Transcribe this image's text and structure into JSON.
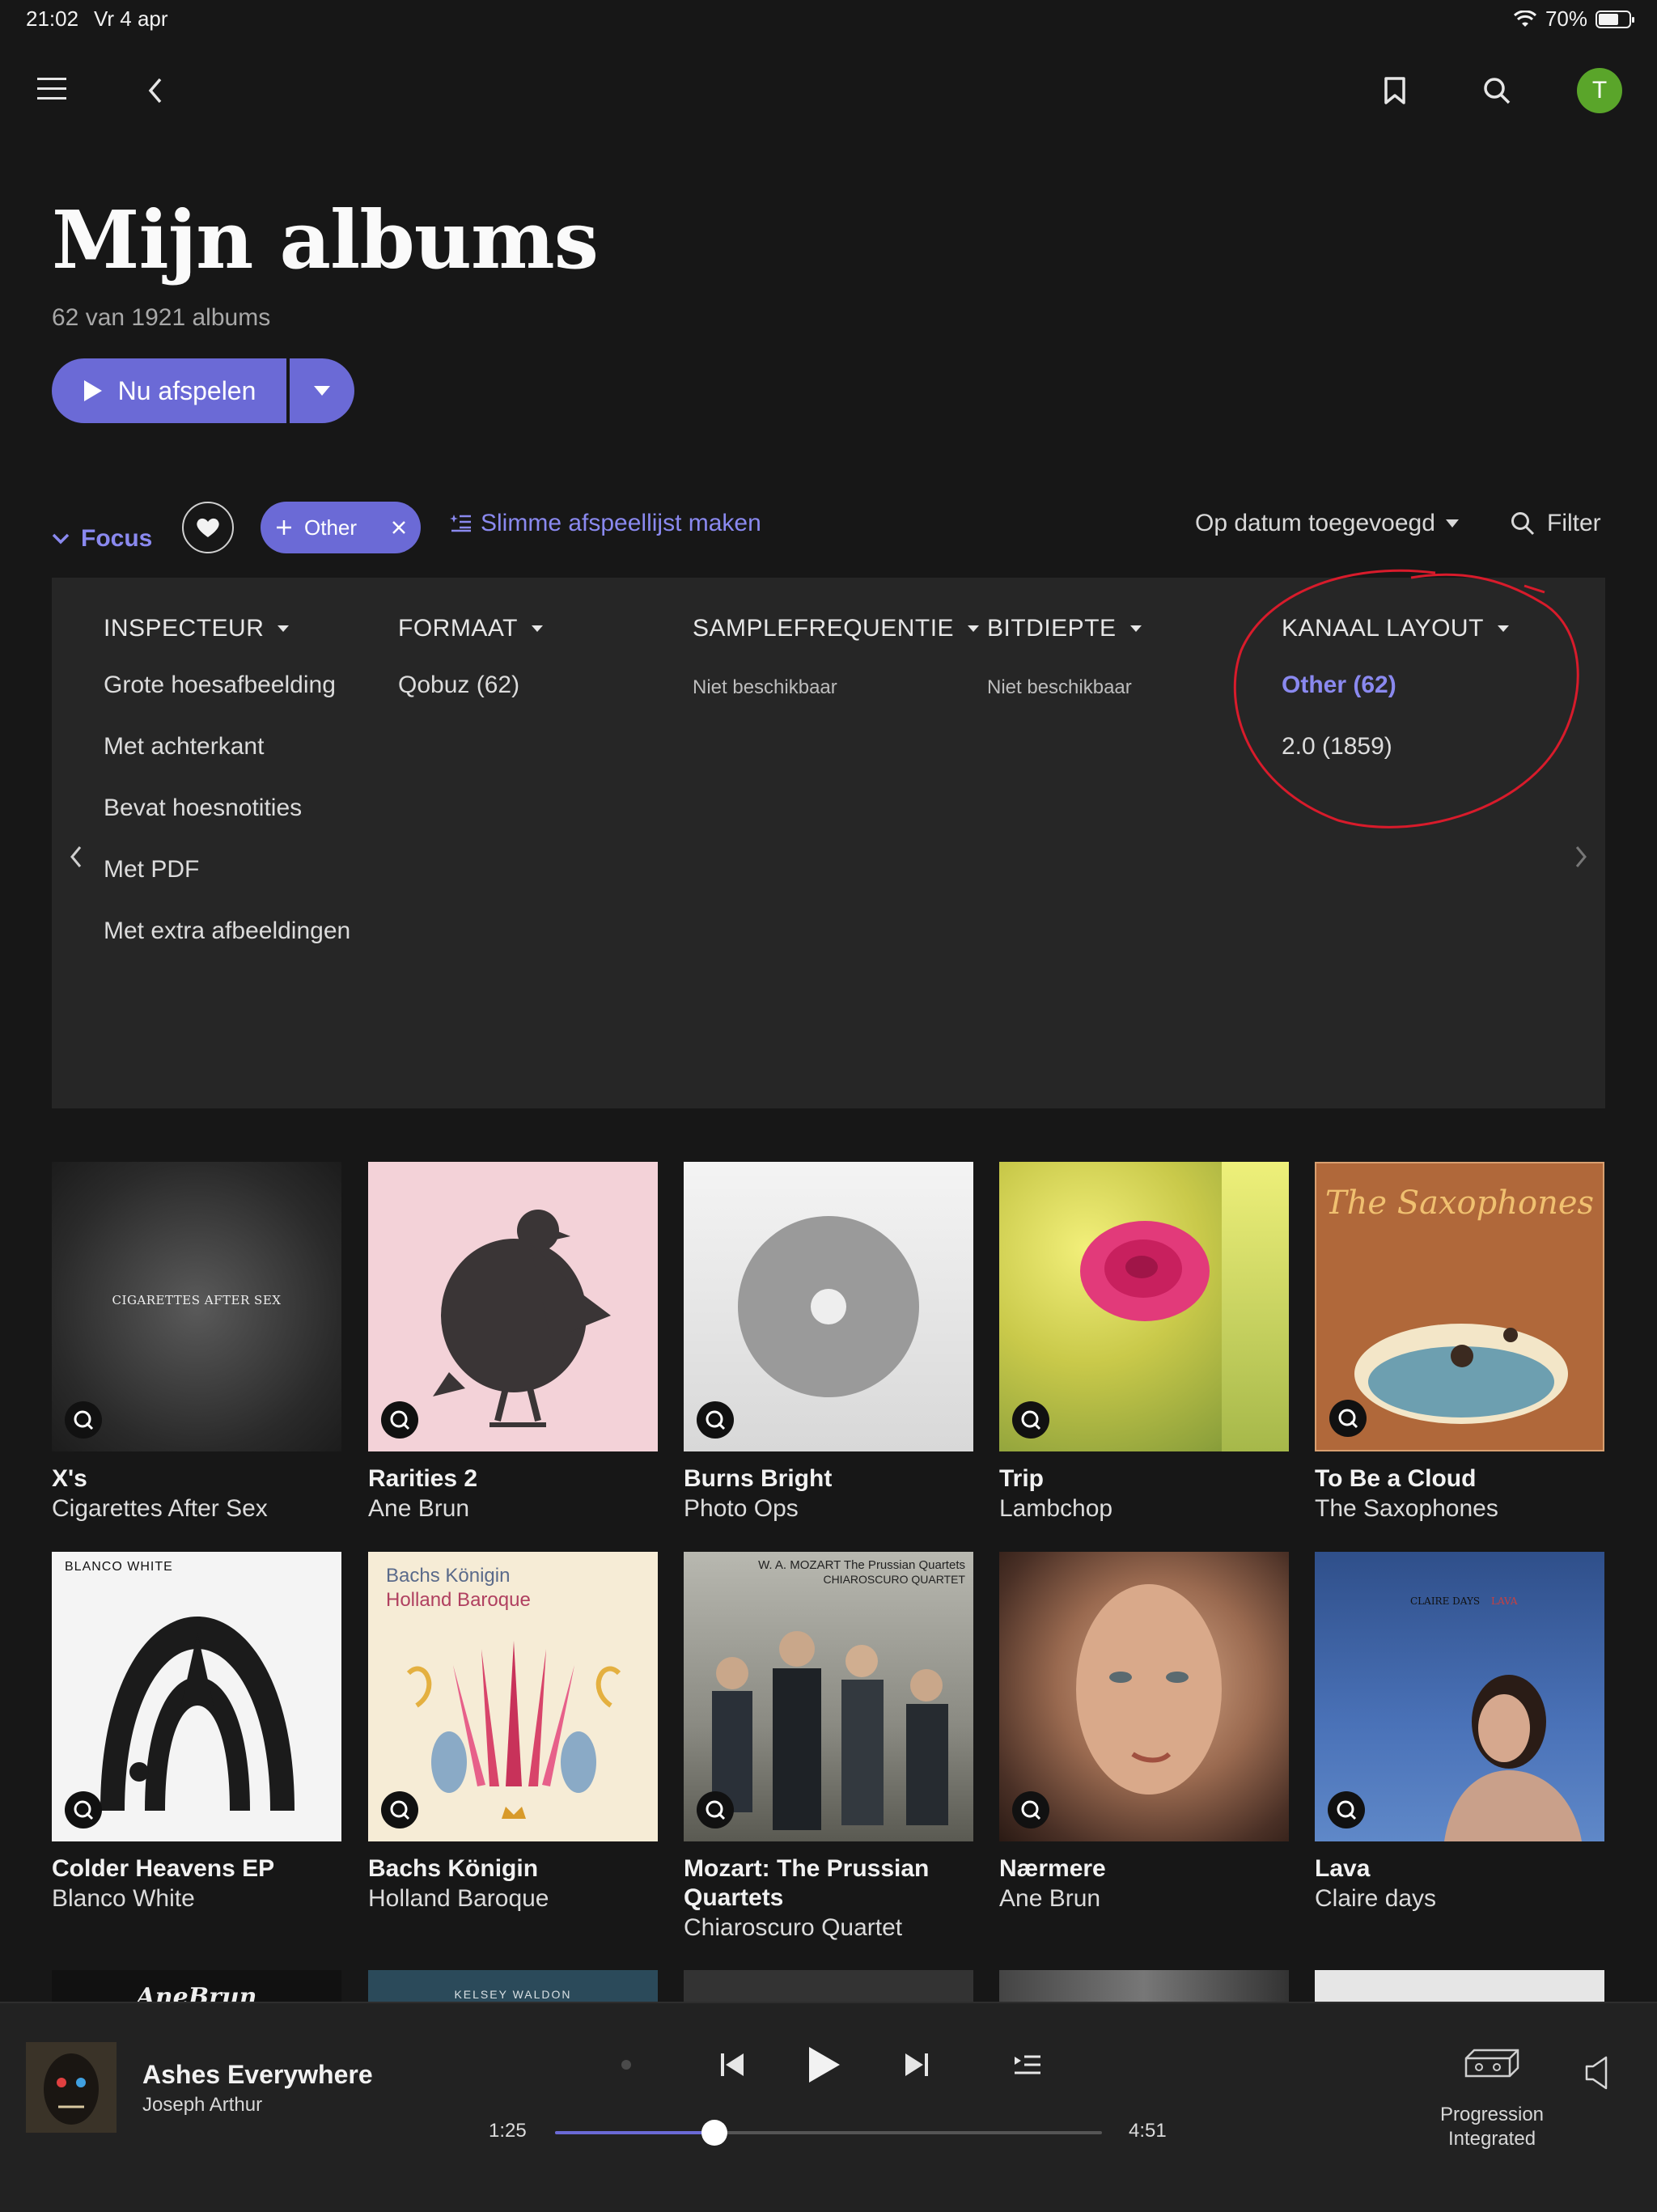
{
  "status": {
    "time": "21:02",
    "date": "Vr 4 apr",
    "battery": "70%",
    "battery_level": 0.7
  },
  "header": {
    "avatar_initial": "T"
  },
  "page": {
    "title": "Mijn albums",
    "subtitle": "62 van 1921 albums",
    "play_label": "Nu afspelen"
  },
  "toolbar": {
    "focus_label": "Focus",
    "chip_label": "Other",
    "smart_playlist_label": "Slimme afspeellijst maken",
    "sort_label": "Op datum toegevoegd",
    "filter_label": "Filter"
  },
  "focus_panel": {
    "columns": [
      {
        "header": "INSPECTEUR",
        "items": [
          "Grote hoesafbeelding",
          "Met achterkant",
          "Bevat hoesnotities",
          "Met PDF",
          "Met extra afbeeldingen"
        ]
      },
      {
        "header": "FORMAAT",
        "items": [
          "Qobuz (62)"
        ]
      },
      {
        "header": "SAMPLEFREQUENTIE",
        "items": [
          "Niet beschikbaar"
        ]
      },
      {
        "header": "BITDIEPTE",
        "items": [
          "Niet beschikbaar"
        ]
      },
      {
        "header": "KANAAL LAYOUT",
        "items": [
          "Other (62)",
          "2.0 (1859)"
        ],
        "selected": "Other (62)"
      }
    ]
  },
  "albums": [
    {
      "title": "X's",
      "artist": "Cigarettes After Sex",
      "cover_text": "CIGARETTES AFTER SEX",
      "color": "#3a3a3a"
    },
    {
      "title": "Rarities 2",
      "artist": "Ane Brun",
      "cover_text": "",
      "color": "#f3d2d8"
    },
    {
      "title": "Burns Bright",
      "artist": "Photo Ops",
      "cover_text": "",
      "color": "#e8e8e8"
    },
    {
      "title": "Trip",
      "artist": "Lambchop",
      "cover_text": "",
      "color": "#d9d25a"
    },
    {
      "title": "To Be a Cloud",
      "artist": "The Saxophones",
      "cover_text": "The Saxophones",
      "color": "#b0683a"
    },
    {
      "title": "Colder Heavens EP",
      "artist": "Blanco White",
      "cover_text": "BLANCO WHITE",
      "color": "#f4f4f4"
    },
    {
      "title": "Bachs Königin",
      "artist": "Holland Baroque",
      "cover_text": "Bachs Königin",
      "cover_sub": "Holland Baroque",
      "color": "#f6ecd6"
    },
    {
      "title": "Mozart: The Prussian Quartets",
      "artist": "Chiaroscuro Quartet",
      "cover_text": "W. A. MOZART  The Prussian Quartets",
      "cover_sub": "CHIAROSCURO QUARTET",
      "color": "#8a8a82"
    },
    {
      "title": "Nærmere",
      "artist": "Ane Brun",
      "cover_text": "",
      "color": "#6a4a3a"
    },
    {
      "title": "Lava",
      "artist": "Claire days",
      "cover_text": "CLAIRE DAYS",
      "cover_sub": "LAVA",
      "color": "#3c5ea0"
    }
  ],
  "partial_row": [
    {
      "cover_text": "AneBrun",
      "color": "#111111"
    },
    {
      "cover_text": "KELSEY WALDON",
      "color": "#2b4a5a"
    },
    {
      "cover_text": "",
      "color": "#333333"
    },
    {
      "cover_text": "",
      "color": "#555555"
    },
    {
      "cover_text": "",
      "color": "#e6e6e6"
    }
  ],
  "player": {
    "title": "Ashes Everywhere",
    "artist": "Joseph Arthur",
    "elapsed": "1:25",
    "duration": "4:51",
    "progress": 0.2921,
    "zone_label_1": "Progression",
    "zone_label_2": "Integrated"
  },
  "colors": {
    "accent": "#6b6ad6",
    "accent_text": "#8a89ef",
    "background": "#171717",
    "panel": "#262626",
    "annotation": "#d81b2b"
  }
}
